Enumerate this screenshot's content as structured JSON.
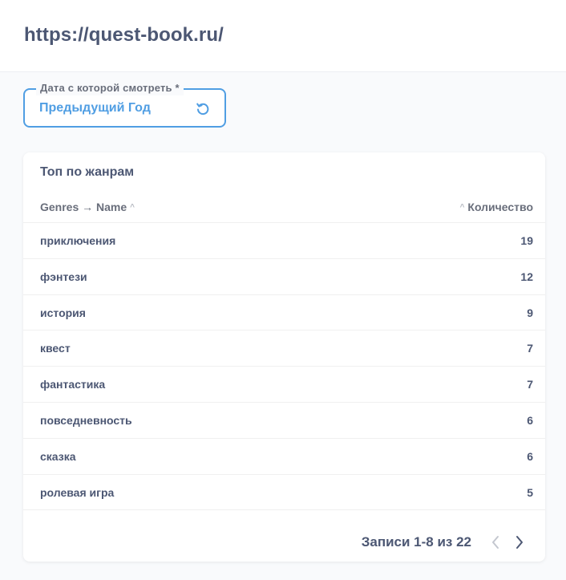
{
  "header": {
    "title": "https://quest-book.ru/"
  },
  "filter": {
    "label": "Дата с которой смотреть *",
    "value": "Предыдущий Год"
  },
  "card": {
    "title": "Топ по жанрам",
    "columns": {
      "name": "Genres → Name",
      "count": "Количество"
    },
    "rows": [
      {
        "name": "приключения",
        "count": "19"
      },
      {
        "name": "фэнтези",
        "count": "12"
      },
      {
        "name": "история",
        "count": "9"
      },
      {
        "name": "квест",
        "count": "7"
      },
      {
        "name": "фантастика",
        "count": "7"
      },
      {
        "name": "повседневность",
        "count": "6"
      },
      {
        "name": "сказка",
        "count": "6"
      },
      {
        "name": "ролевая игра",
        "count": "5"
      }
    ],
    "pagination": {
      "info": "Записи 1-8 из 22"
    }
  },
  "colors": {
    "accent": "#509ee3",
    "text": "#4c5773",
    "muted": "#696e7b"
  },
  "icons": {
    "reset": "refresh-icon",
    "prev": "chevron-left-icon",
    "next": "chevron-right-icon",
    "sort": "sort-caret-icon"
  }
}
